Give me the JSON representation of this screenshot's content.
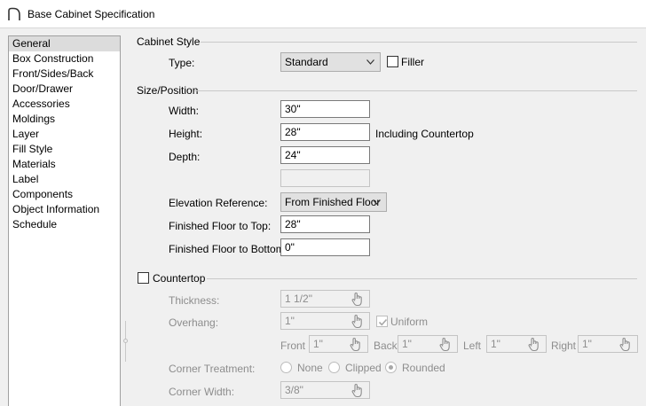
{
  "window": {
    "title": "Base Cabinet Specification"
  },
  "sidebar": {
    "items": [
      "General",
      "Box Construction",
      "Front/Sides/Back",
      "Door/Drawer",
      "Accessories",
      "Moldings",
      "Layer",
      "Fill Style",
      "Materials",
      "Label",
      "Components",
      "Object Information",
      "Schedule"
    ],
    "selected": "General"
  },
  "cabinet_style": {
    "title": "Cabinet Style",
    "type_label": "Type:",
    "type_value": "Standard",
    "filler_label": "Filler",
    "filler_checked": false
  },
  "size_position": {
    "title": "Size/Position",
    "width_label": "Width:",
    "width_value": "30\"",
    "height_label": "Height:",
    "height_value": "28\"",
    "height_note": "Including Countertop",
    "depth_label": "Depth:",
    "depth_value": "24\"",
    "extra_value": "",
    "elevation_label": "Elevation Reference:",
    "elevation_value": "From Finished Floor",
    "floor_top_label": "Finished Floor to Top:",
    "floor_top_value": "28\"",
    "floor_bottom_label": "Finished Floor to Bottom:",
    "floor_bottom_value": "0\""
  },
  "countertop": {
    "label": "Countertop",
    "checked": false,
    "thickness_label": "Thickness:",
    "thickness_value": "1 1/2\"",
    "overhang_label": "Overhang:",
    "overhang_value": "1\"",
    "uniform_label": "Uniform",
    "uniform_checked": true,
    "front_label": "Front",
    "front_value": "1\"",
    "back_label": "Back",
    "back_value": "1\"",
    "left_label": "Left",
    "left_value": "1\"",
    "right_label": "Right",
    "right_value": "1\"",
    "corner_treatment_label": "Corner Treatment:",
    "corner_options": [
      "None",
      "Clipped",
      "Rounded"
    ],
    "corner_selected": "Rounded",
    "corner_width_label": "Corner Width:",
    "corner_width_value": "3/8\""
  },
  "colors": {
    "background": "#f0f0f0",
    "selected_item": "#dcdcdc",
    "disabled_text": "#8d8d8d"
  }
}
